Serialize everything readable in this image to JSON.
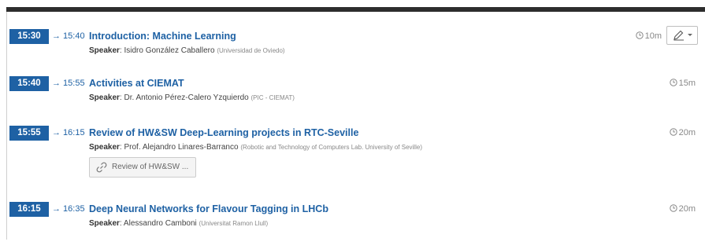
{
  "timetable": {
    "entries": [
      {
        "start": "15:30",
        "end": "→ 15:40",
        "title": "Introduction: Machine Learning",
        "speaker_label": "Speaker",
        "speaker_name": ": Isidro González Caballero",
        "affiliation": "(Universidad de Oviedo)",
        "duration": "10m"
      },
      {
        "start": "15:40",
        "end": "→ 15:55",
        "title": "Activities at CIEMAT",
        "speaker_label": "Speaker",
        "speaker_name": ": Dr. Antonio Pérez-Calero Yzquierdo",
        "affiliation": "(PIC - CIEMAT)",
        "duration": "15m"
      },
      {
        "start": "15:55",
        "end": "→ 16:15",
        "title": "Review of HW&SW Deep-Learning projects in RTC-Seville",
        "speaker_label": "Speaker",
        "speaker_name": ": Prof. Alejandro Linares-Barranco",
        "affiliation": "(Robotic and Technology of Computers Lab. University of Seville)",
        "duration": "20m",
        "attachment": "Review of HW&SW ..."
      },
      {
        "start": "16:15",
        "end": "→ 16:35",
        "title": "Deep Neural Networks for Flavour Tagging in LHCb",
        "speaker_label": "Speaker",
        "speaker_name": ": Alessandro Camboni",
        "affiliation": "(Universitat Ramon Llull)",
        "duration": "20m"
      }
    ]
  },
  "icons": {
    "clock": "clock-icon",
    "edit": "pencil-icon",
    "dropdown": "caret-down-icon",
    "attachment": "paperclip-link-icon"
  },
  "colors": {
    "accent": "#1e61a4",
    "muted": "#888888",
    "topbar": "#2d2d2d"
  }
}
